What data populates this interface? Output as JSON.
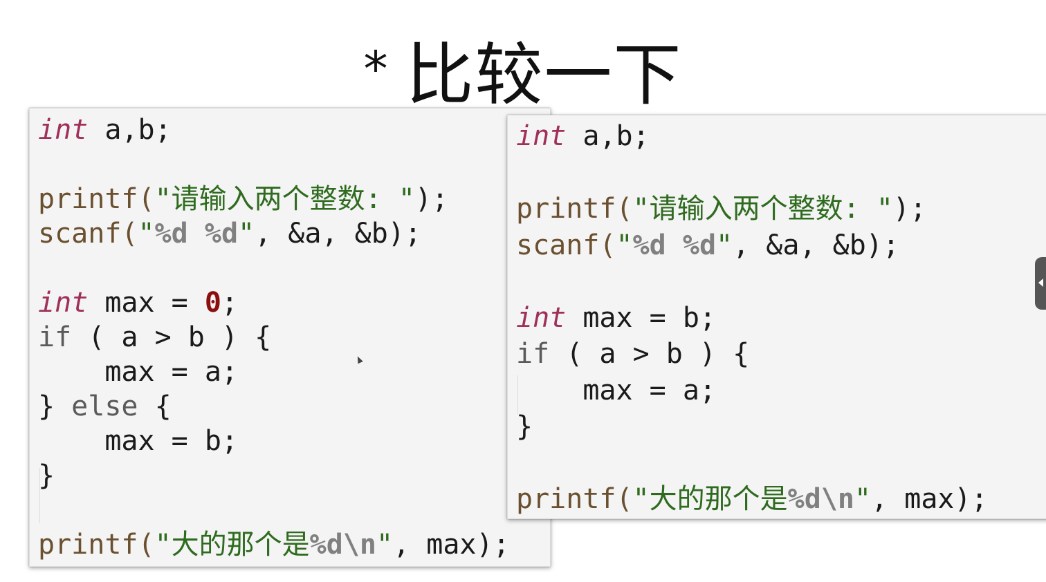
{
  "title": {
    "star": "*",
    "text": "比较一下"
  },
  "left_code": {
    "line1": {
      "kw": "int",
      "rest": " a,b;"
    },
    "line3": {
      "fn": "printf(",
      "str": "\"请输入两个整数: \"",
      "end": ");"
    },
    "line4": {
      "fn": "scanf(",
      "q1": "\"",
      "fmt1": "%d",
      "sp": " ",
      "fmt2": "%d",
      "q2": "\"",
      "end": ", &a, &b);"
    },
    "line6": {
      "kw": "int",
      "mid": " max = ",
      "num": "0",
      "end": ";"
    },
    "line7": {
      "kw": "if",
      "rest": " ( a > b ) {"
    },
    "line8": {
      "text": "    max = a;"
    },
    "line9": {
      "open": "} ",
      "kw": "else",
      "rest": " {"
    },
    "line10": {
      "text": "    max = b;"
    },
    "line11": {
      "text": "}"
    },
    "line13": {
      "fn": "printf(",
      "str1": "\"大的那个是",
      "fmt": "%d\\n",
      "str2": "\"",
      "end": ", max);"
    }
  },
  "right_code": {
    "line1": {
      "kw": "int",
      "rest": " a,b;"
    },
    "line3": {
      "fn": "printf(",
      "str": "\"请输入两个整数: \"",
      "end": ");"
    },
    "line4": {
      "fn": "scanf(",
      "q1": "\"",
      "fmt1": "%d",
      "sp": " ",
      "fmt2": "%d",
      "q2": "\"",
      "end": ", &a, &b);"
    },
    "line6": {
      "kw": "int",
      "rest": " max = b;"
    },
    "line7": {
      "kw": "if",
      "rest": " ( a > b ) {"
    },
    "line8": {
      "text": "    max = a;"
    },
    "line9": {
      "text": "}"
    },
    "line11": {
      "fn": "printf(",
      "str1": "\"大的那个是",
      "fmt": "%d\\n",
      "str2": "\"",
      "end": ", max);"
    }
  },
  "colors": {
    "keyword_int": "#a0305a",
    "string": "#2f6b1f",
    "format_spec": "#808080",
    "number": "#8a1010",
    "panel_bg": "#f4f4f4"
  },
  "icons": {
    "mouse_cursor": "cursor-icon",
    "side_tab": "chevron-left-icon"
  }
}
